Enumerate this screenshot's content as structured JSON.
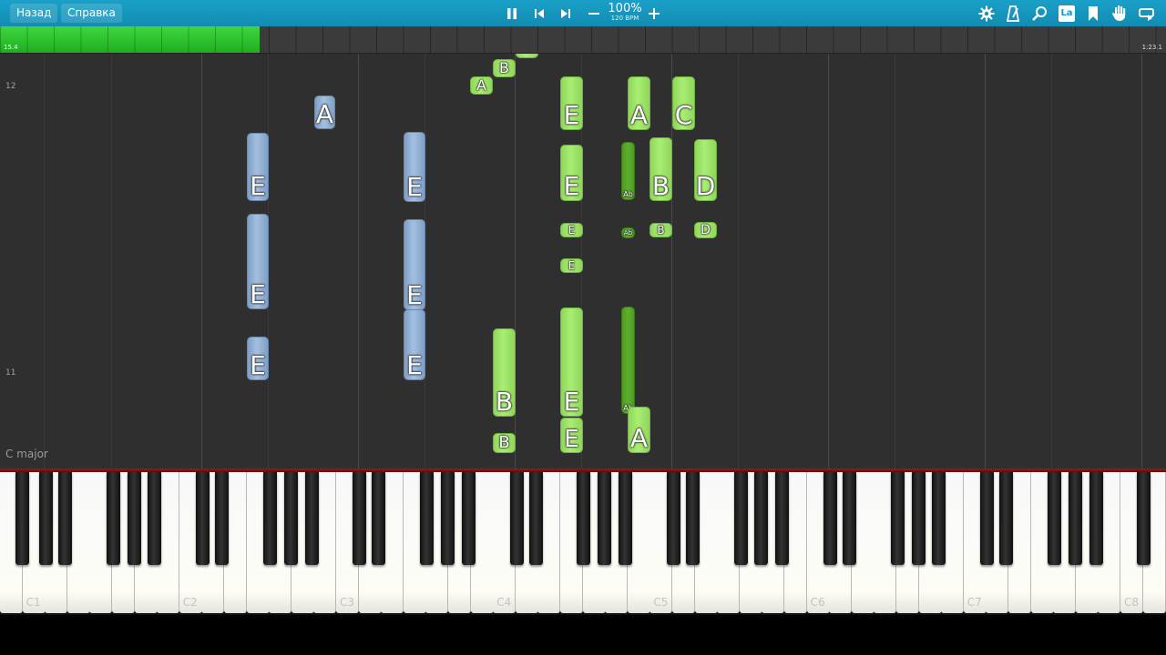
{
  "toolbar": {
    "back_label": "Назад",
    "help_label": "Справка",
    "speed_percent": "100%",
    "speed_bpm": "120 BPM",
    "key_label_icon_text": "La",
    "icons": [
      "pause-icon",
      "previous-icon",
      "next-icon",
      "minus-icon",
      "plus-icon",
      "gear-icon",
      "metronome-icon",
      "search-icon",
      "key-labels-icon",
      "bookmark-icon",
      "hand-icon",
      "loop-icon"
    ]
  },
  "timeline": {
    "elapsed": "15.4",
    "total": "1:23.1",
    "progress_fraction": 0.223
  },
  "roll": {
    "measure_labels": [
      {
        "text": "12"
      },
      {
        "text": "11"
      }
    ],
    "key_signature": "C major"
  },
  "notes": [
    {
      "label": "A",
      "color": "blue"
    },
    {
      "label": "E",
      "color": "blue"
    },
    {
      "label": "E",
      "color": "blue"
    },
    {
      "label": "E",
      "color": "blue"
    },
    {
      "label": "E",
      "color": "blue"
    },
    {
      "label": "E",
      "color": "blue"
    },
    {
      "label": "E",
      "color": "blue"
    },
    {
      "label": "B",
      "color": "green"
    },
    {
      "label": "A",
      "color": "green"
    },
    {
      "label": "",
      "color": "green"
    },
    {
      "label": "B",
      "color": "green"
    },
    {
      "label": "B",
      "color": "green"
    },
    {
      "label": "E",
      "color": "green"
    },
    {
      "label": "E",
      "color": "green"
    },
    {
      "label": "E",
      "color": "green"
    },
    {
      "label": "E",
      "color": "green"
    },
    {
      "label": "E",
      "color": "green"
    },
    {
      "label": "E",
      "color": "green"
    },
    {
      "label": "Ab",
      "color": "dark-green"
    },
    {
      "label": "Ab",
      "color": "dark-green"
    },
    {
      "label": "Ab",
      "color": "dark-green"
    },
    {
      "label": "A",
      "color": "green"
    },
    {
      "label": "A",
      "color": "green"
    },
    {
      "label": "B",
      "color": "green"
    },
    {
      "label": "B",
      "color": "green"
    },
    {
      "label": "C",
      "color": "green"
    },
    {
      "label": "D",
      "color": "green"
    },
    {
      "label": "D",
      "color": "green"
    }
  ],
  "keyboard": {
    "c_labels": [
      "C1",
      "C2",
      "C3",
      "C4",
      "C5",
      "C6",
      "C7",
      "C8"
    ]
  },
  "colors": {
    "toolbar": "#1597bf",
    "progress": "#2ec42e",
    "note_green": "#a0e66a",
    "note_dark_green": "#56a528",
    "note_blue": "#94b1d6",
    "playline": "#8e1414"
  }
}
